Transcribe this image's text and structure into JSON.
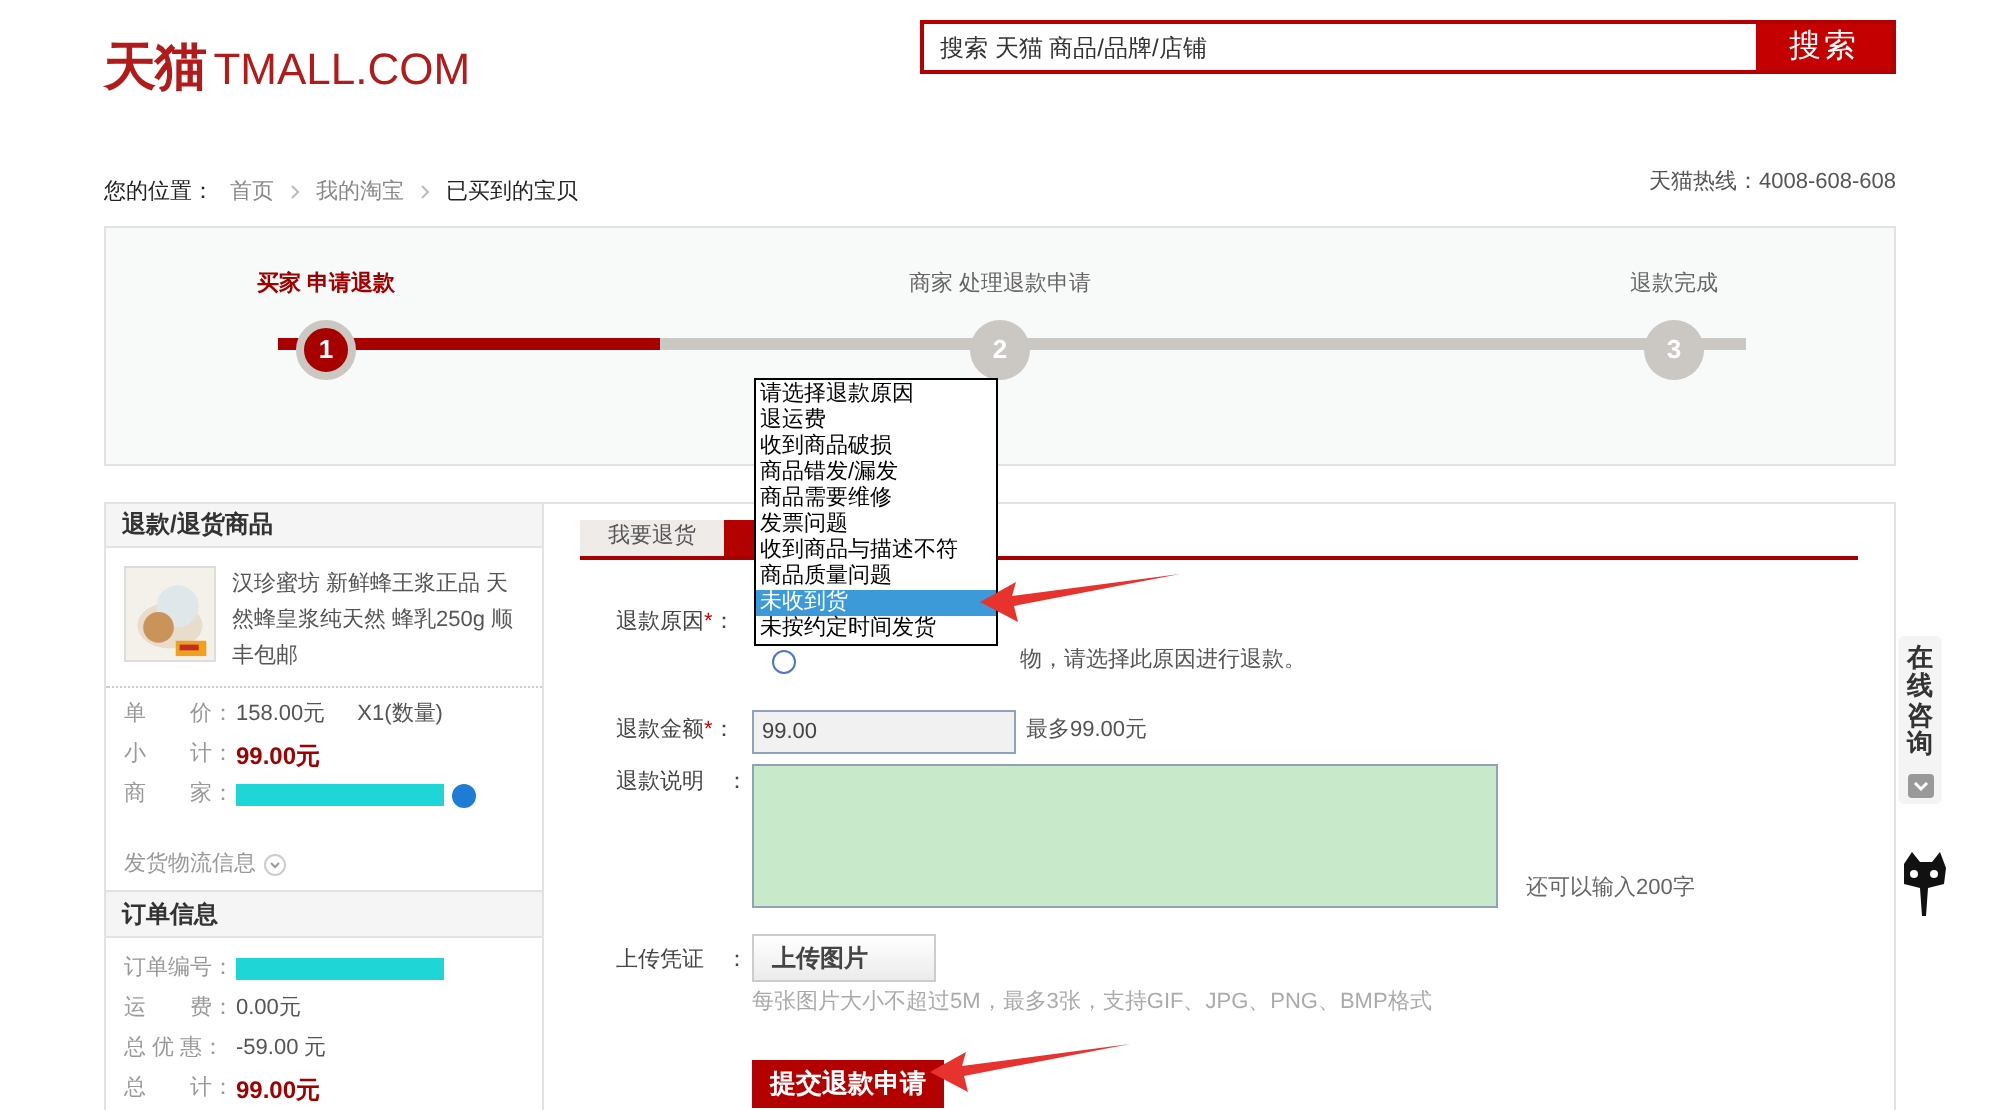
{
  "header": {
    "logo": {
      "cn": "天猫",
      "en": "TMALL.COM"
    },
    "search": {
      "placeholder": "搜索 天猫 商品/品牌/店铺",
      "button": "搜索"
    }
  },
  "breadcrumb": {
    "label": "您的位置：",
    "items": [
      {
        "text": "首页",
        "current": false
      },
      {
        "text": "我的淘宝",
        "current": false
      },
      {
        "text": "已买到的宝贝",
        "current": true
      }
    ],
    "hotline": "天猫热线：4008-608-608"
  },
  "steps": {
    "level": 0.26,
    "items": [
      {
        "label": "买家 申请退款",
        "number": "1",
        "selected": true
      },
      {
        "label": "商家 处理退款申请",
        "number": "2",
        "selected": false
      },
      {
        "label": "退款完成",
        "number": "3",
        "selected": false
      }
    ]
  },
  "product_panel": {
    "title": "退款/退货商品",
    "product_title": "汉珍蜜坊 新鲜蜂王浆正品 天然蜂皇浆纯天然 蜂乳250g 顺丰包邮",
    "rows": [
      {
        "kind": "plain",
        "label": "单　　价：",
        "value": "158.00元",
        "extra": "X1(数量)"
      },
      {
        "kind": "total",
        "label": "小　　计：",
        "value": "99.00元"
      },
      {
        "kind": "masked",
        "label": "商　　家："
      }
    ],
    "logistics": "发货物流信息"
  },
  "order_panel": {
    "title": "订单信息",
    "rows": [
      {
        "kind": "masked",
        "label": "订单编号："
      },
      {
        "kind": "plain",
        "label": "运　　费：",
        "value": "0.00元"
      },
      {
        "kind": "plain",
        "label": "总 优 惠：",
        "value": "-59.00 元"
      },
      {
        "kind": "total",
        "label": "总　　计：",
        "value": "99.00元"
      }
    ]
  },
  "tabs": [
    {
      "label": "我要退货",
      "selected": false
    },
    {
      "selected": true
    }
  ],
  "form": {
    "reason_label": "退款原因",
    "required": "*",
    "colon": "：",
    "reason_hint": "物，请选择此原因进行退款。",
    "amount_label": "退款金额",
    "amount_value": "99.00",
    "amount_max": "最多99.00元",
    "description_label": "退款说明　：",
    "remaining": "还可以输入200字",
    "upload_label": "上传凭证　：",
    "upload_button": "上传图片",
    "upload_hint": "每张图片大小不超过5M，最多3张，支持GIF、JPG、PNG、BMP格式",
    "submit": "提交退款申请"
  },
  "reason_dropdown": {
    "options": [
      {
        "text": "请选择退款原因",
        "selected": false
      },
      {
        "text": "退运费",
        "selected": false
      },
      {
        "text": "收到商品破损",
        "selected": false
      },
      {
        "text": "商品错发/漏发",
        "selected": false
      },
      {
        "text": "商品需要维修",
        "selected": false
      },
      {
        "text": "发票问题",
        "selected": false
      },
      {
        "text": "收到商品与描述不符",
        "selected": false
      },
      {
        "text": "商品质量问题",
        "selected": false
      },
      {
        "text": "未收到货",
        "selected": true
      },
      {
        "text": "未按约定时间发货",
        "selected": false
      }
    ]
  },
  "side_widget": {
    "label": "在线咨询"
  }
}
